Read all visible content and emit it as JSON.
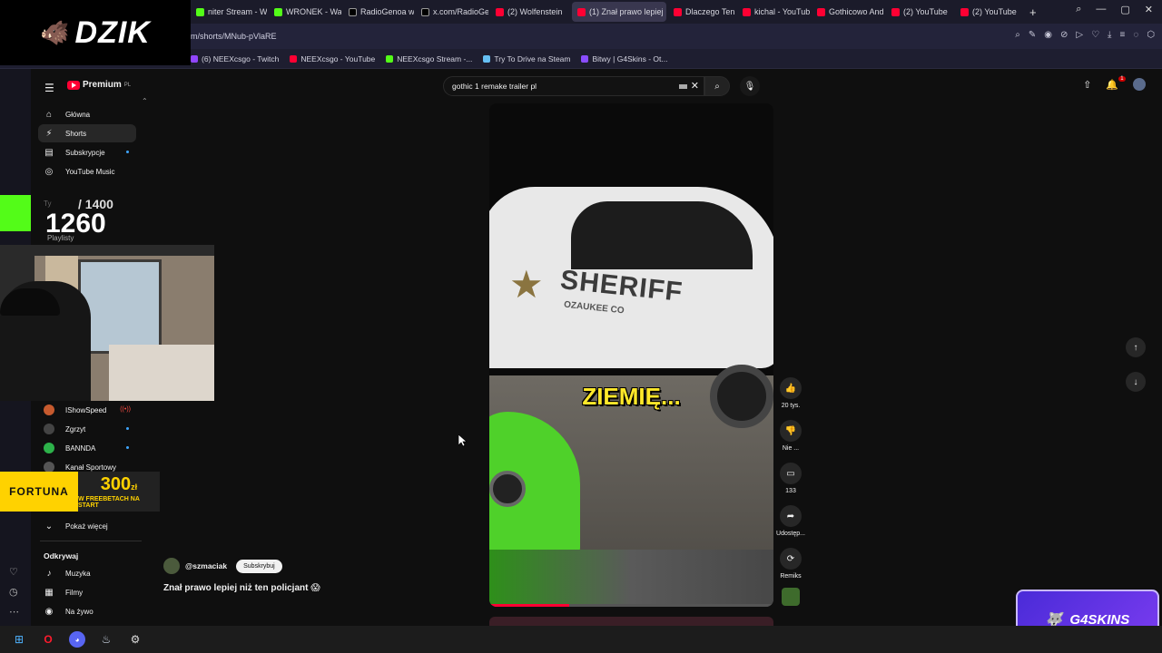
{
  "browser": {
    "tabs": [
      {
        "label": "niter Stream - W",
        "icon": "kick-icon"
      },
      {
        "label": "WRONEK - Watc",
        "icon": "kick-icon"
      },
      {
        "label": "RadioGenoa w si",
        "icon": "x-icon"
      },
      {
        "label": "x.com/RadioGen",
        "icon": "x-icon"
      },
      {
        "label": "(2) Wolfenstein",
        "icon": "youtube-icon"
      },
      {
        "label": "(1) Znał prawo lepiej",
        "icon": "youtube-icon"
      },
      {
        "label": "Dlaczego Ten Yo",
        "icon": "youtube-icon"
      },
      {
        "label": "kichal - YouTube",
        "icon": "youtube-icon"
      },
      {
        "label": "Gothicowo Andr",
        "icon": "youtube-icon"
      },
      {
        "label": "(2) YouTube",
        "icon": "youtube-icon"
      },
      {
        "label": "(2) YouTube",
        "icon": "youtube-icon"
      }
    ],
    "url": "m/shorts/MNub-pVlaRE",
    "bookmarks": [
      {
        "label": "(6) NEEXcsgo - Twitch",
        "icon": "twitch-icon"
      },
      {
        "label": "NEEXcsgo - YouTube",
        "icon": "youtube-icon"
      },
      {
        "label": "NEEXcsgo Stream -...",
        "icon": "kick-icon"
      },
      {
        "label": "Try To Drive na Steam",
        "icon": "steam-icon"
      },
      {
        "label": "Bitwy | G4Skins - Ot...",
        "icon": "g4skins-icon"
      }
    ]
  },
  "youtube": {
    "logo": "Premium",
    "logo_region": "PL",
    "search_value": "gothic 1 remake trailer pl",
    "nav": [
      {
        "label": "Główna",
        "icon": "home-icon"
      },
      {
        "label": "Shorts",
        "icon": "shorts-icon"
      },
      {
        "label": "Subskrypcje",
        "icon": "subscriptions-icon"
      },
      {
        "label": "YouTube Music",
        "icon": "music-icon"
      }
    ],
    "nav_partial": {
      "you": "Ty",
      "playlists": "Playlisty"
    },
    "subscriptions": [
      {
        "label": "IShowSpeed",
        "color": "#c65a2e"
      },
      {
        "label": "Zgrzyt",
        "color": "#444"
      },
      {
        "label": "BANNDA",
        "color": "#2db24a"
      },
      {
        "label": "Kanał Sportowy",
        "color": "#555"
      }
    ],
    "show_more": "Pokaż więcej",
    "explore_title": "Odkrywaj",
    "explore": [
      {
        "label": "Muzyka",
        "icon": "music-note-icon"
      },
      {
        "label": "Filmy",
        "icon": "film-icon"
      },
      {
        "label": "Na żywo",
        "icon": "live-icon"
      }
    ]
  },
  "short": {
    "caption": "ZIEMIĘ...",
    "car_text": "SHERIFF",
    "car_subtext": "OZAUKEE CO",
    "channel": "@szmaciak",
    "subscribe": "Subskrybuj",
    "title": "Znał prawo lepiej niż ten policjant 😱",
    "progress": 0.28,
    "actions": [
      {
        "label": "20 tys.",
        "icon": "like-icon"
      },
      {
        "label": "Nie ...",
        "icon": "dislike-icon"
      },
      {
        "label": "133",
        "icon": "comment-icon"
      },
      {
        "label": "Udostęp...",
        "icon": "share-icon"
      },
      {
        "label": "Remiks",
        "icon": "remix-icon"
      }
    ]
  },
  "overlays": {
    "dzik": "DZIK",
    "counter_you": "Ty",
    "counter_total": "/ 1400",
    "counter_current": "1260",
    "fortuna_brand": "FORTUNA",
    "fortuna_amount": "300",
    "fortuna_currency": "zł",
    "fortuna_promo": "W FREEBETACH NA START",
    "g4skins": "G4SKINS"
  }
}
